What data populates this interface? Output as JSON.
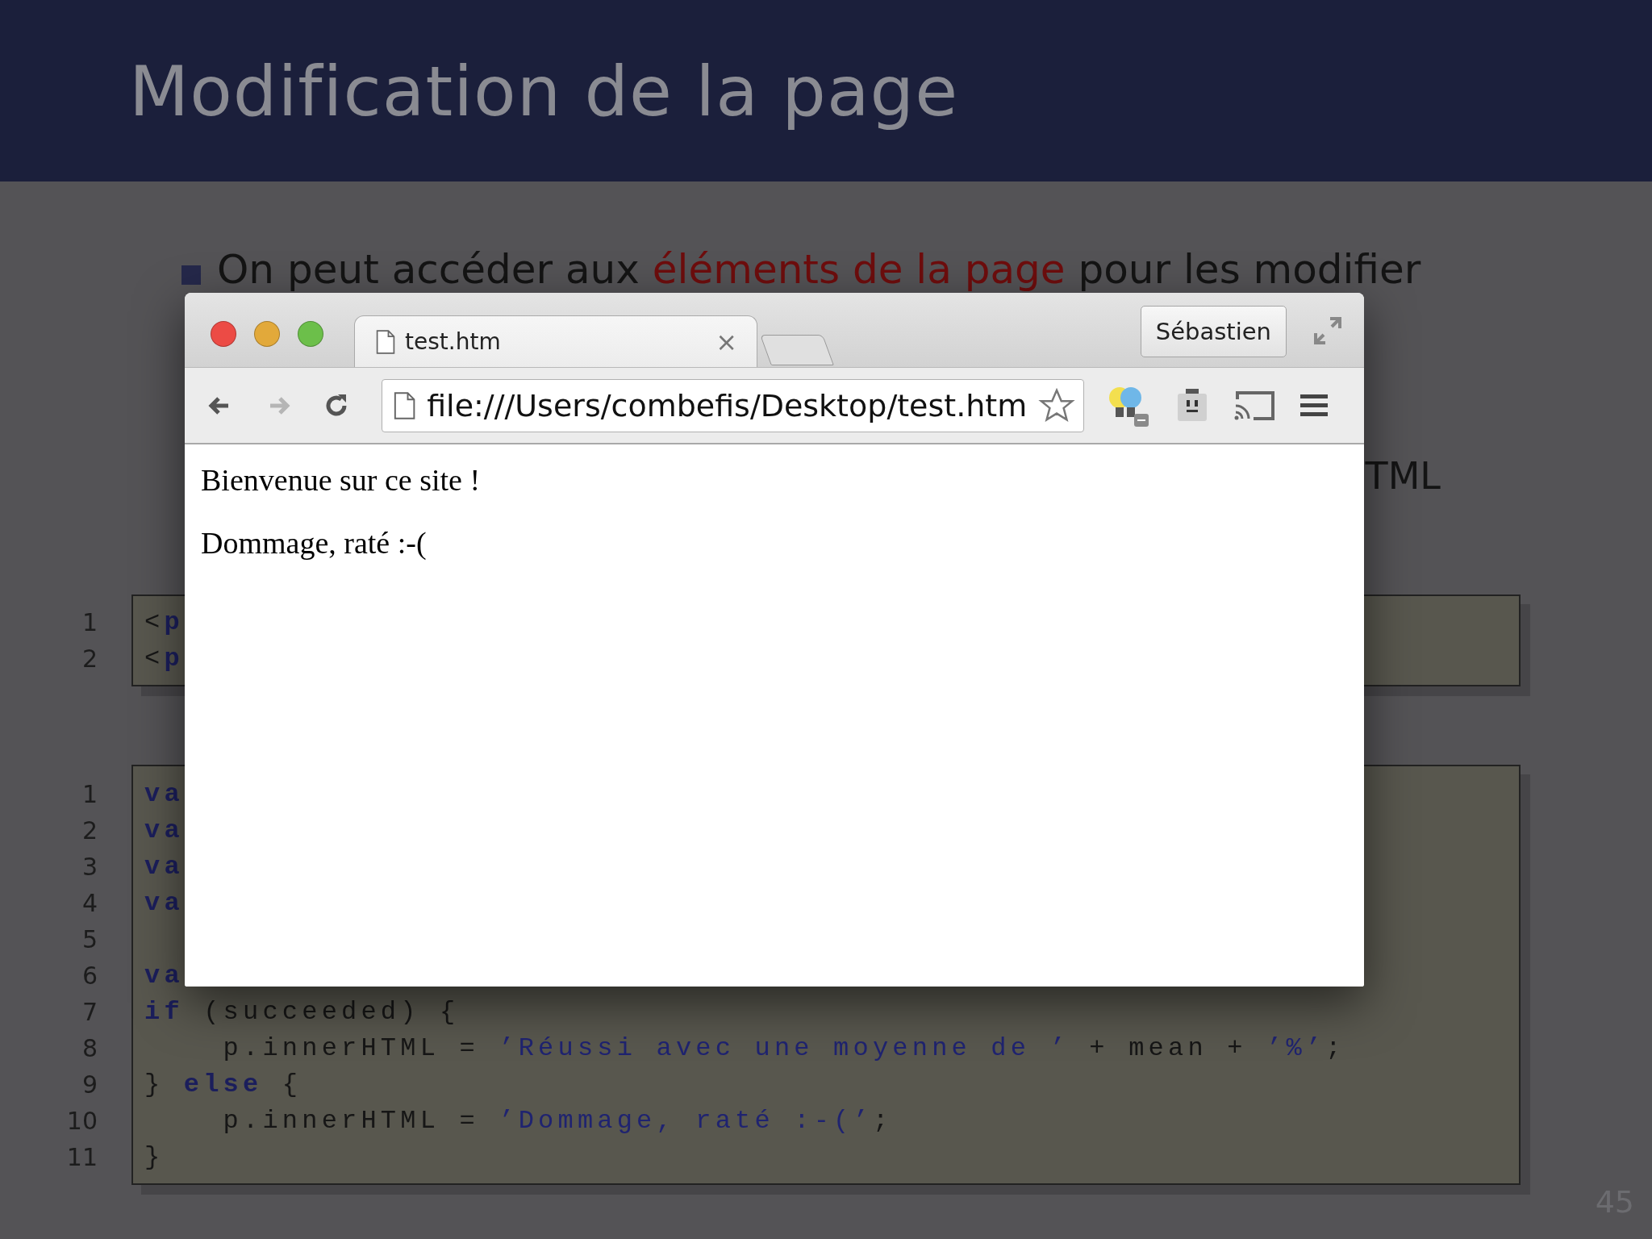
{
  "slide": {
    "title": "Modification de la page",
    "bullet": "On peut accéder aux **éléments de la page** pour les modifier",
    "partial_text": "TML",
    "page_number": "45"
  },
  "code_blocks": [
    {
      "lines": [
        {
          "number": "1",
          "segments": [
            {
              "kind": "plain",
              "text": "<"
            },
            {
              "kind": "keyword",
              "text": "p"
            }
          ]
        },
        {
          "number": "2",
          "segments": [
            {
              "kind": "plain",
              "text": "<"
            },
            {
              "kind": "keyword",
              "text": "p"
            }
          ]
        }
      ]
    },
    {
      "lines": [
        {
          "number": "1",
          "segments": [
            {
              "kind": "keyword",
              "text": "va"
            }
          ]
        },
        {
          "number": "2",
          "segments": [
            {
              "kind": "keyword",
              "text": "va"
            }
          ]
        },
        {
          "number": "3",
          "segments": [
            {
              "kind": "keyword",
              "text": "va"
            }
          ]
        },
        {
          "number": "4",
          "segments": [
            {
              "kind": "keyword",
              "text": "va"
            }
          ]
        },
        {
          "number": "5"
        },
        {
          "number": "6",
          "segments": [
            {
              "kind": "keyword",
              "text": "va"
            }
          ]
        },
        {
          "number": "7",
          "segments": [
            {
              "kind": "keyword",
              "text": "if"
            },
            {
              "kind": "plain",
              "text": " (succeeded) {"
            }
          ]
        },
        {
          "number": "8",
          "segments": [
            {
              "kind": "plain",
              "text": "    p.innerHTML = "
            },
            {
              "kind": "string",
              "text": "’Réussi avec une moyenne de ’"
            },
            {
              "kind": "plain",
              "text": " + mean + "
            },
            {
              "kind": "string",
              "text": "’%’"
            },
            {
              "kind": "plain",
              "text": ";"
            }
          ]
        },
        {
          "number": "9",
          "segments": [
            {
              "kind": "plain",
              "text": "} "
            },
            {
              "kind": "keyword",
              "text": "else"
            },
            {
              "kind": "plain",
              "text": " {"
            }
          ]
        },
        {
          "number": "10",
          "segments": [
            {
              "kind": "plain",
              "text": "    p.innerHTML = "
            },
            {
              "kind": "string",
              "text": "’Dommage, raté :-(’"
            },
            {
              "kind": "plain",
              "text": ";"
            }
          ]
        },
        {
          "number": "11",
          "segments": [
            {
              "kind": "plain",
              "text": "}"
            }
          ]
        }
      ]
    }
  ],
  "browser": {
    "tab": {
      "title": "test.htm",
      "close": "×"
    },
    "profile": "Sébastien",
    "address": "file:///Users/combefis/Desktop/test.htm",
    "nav": [
      {
        "kind": "back",
        "disabled": false
      },
      {
        "kind": "forward",
        "disabled": true
      },
      {
        "kind": "reload",
        "disabled": false
      }
    ],
    "content": [
      "Bienvenue sur ce site !",
      "Dommage, raté :-("
    ]
  }
}
